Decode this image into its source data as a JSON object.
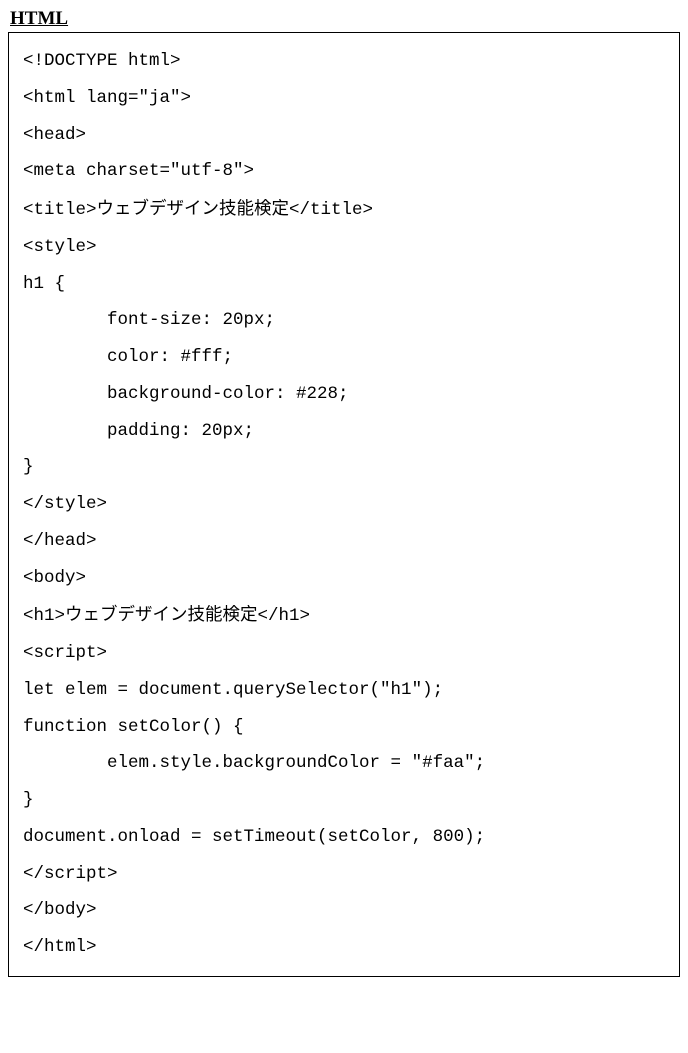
{
  "label": "HTML",
  "code": {
    "line1": "<!DOCTYPE html>",
    "line2": "<html lang=\"ja\">",
    "line3": "<head>",
    "line4": "<meta charset=\"utf-8\">",
    "line5a": "<title>",
    "line5b": "ウェブデザイン技能検定",
    "line5c": "</title>",
    "line6": "<style>",
    "line7": "h1 {",
    "line8": "        font-size: 20px;",
    "line9": "        color: #fff;",
    "line10": "        background-color: #228;",
    "line11": "        padding: 20px;",
    "line12": "}",
    "line13": "</style>",
    "line14": "</head>",
    "line15": "<body>",
    "line16a": "<h1>",
    "line16b": "ウェブデザイン技能検定",
    "line16c": "</h1>",
    "line17": "<script>",
    "line18": "let elem = document.querySelector(\"h1\");",
    "line19": "function setColor() {",
    "line20": "        elem.style.backgroundColor = \"#faa\";",
    "line21": "}",
    "line22": "document.onload = setTimeout(setColor, 800);",
    "line23": "</script>",
    "line24": "</body>",
    "line25": "</html>"
  }
}
